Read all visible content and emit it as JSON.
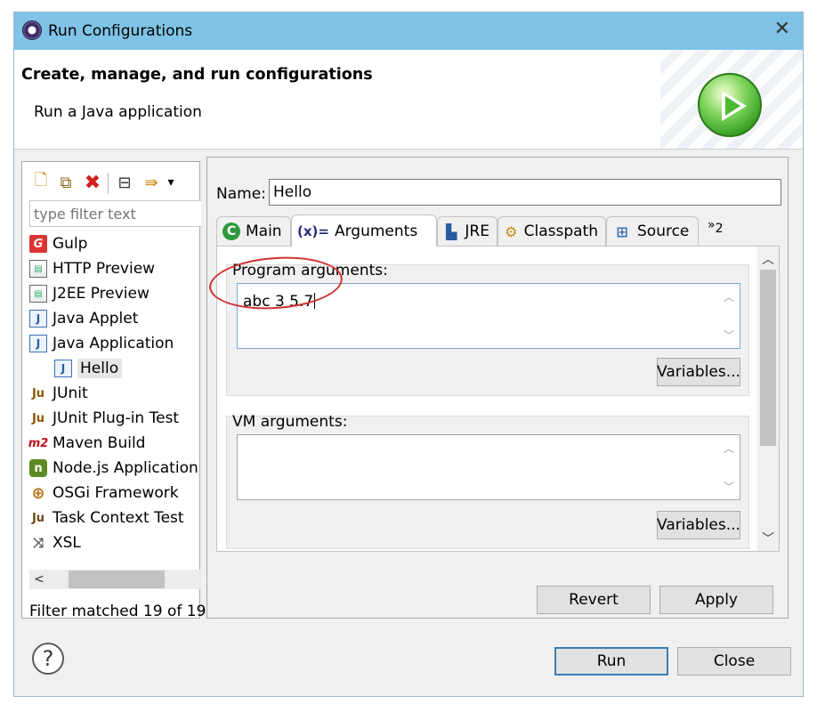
{
  "window": {
    "title": "Run Configurations",
    "close_symbol": "✕"
  },
  "header": {
    "title": "Create, manage, and run configurations",
    "subtitle": "Run a Java application"
  },
  "left_panel": {
    "filter_placeholder": "type filter text",
    "tree": [
      {
        "label": "Gulp",
        "icon": "gulp-icon",
        "glyph": "G"
      },
      {
        "label": "HTTP Preview",
        "icon": "http-preview-icon",
        "glyph": "▤"
      },
      {
        "label": "J2EE Preview",
        "icon": "j2ee-preview-icon",
        "glyph": "▤"
      },
      {
        "label": "Java Applet",
        "icon": "java-applet-icon",
        "glyph": "J"
      },
      {
        "label": "Java Application",
        "icon": "java-application-icon",
        "glyph": "J"
      },
      {
        "label": "Hello",
        "icon": "java-launch-icon",
        "glyph": "J",
        "child": true,
        "selected": true
      },
      {
        "label": "JUnit",
        "icon": "junit-icon",
        "glyph": "Ju"
      },
      {
        "label": "JUnit Plug-in Test",
        "icon": "junit-plugin-icon",
        "glyph": "Ju"
      },
      {
        "label": "Maven Build",
        "icon": "maven-icon",
        "glyph": "m2"
      },
      {
        "label": "Node.js Application",
        "icon": "nodejs-icon",
        "glyph": "n"
      },
      {
        "label": "OSGi Framework",
        "icon": "osgi-icon",
        "glyph": "⊕"
      },
      {
        "label": "Task Context Test",
        "icon": "task-context-icon",
        "glyph": "Ju"
      },
      {
        "label": "XSL",
        "icon": "xsl-icon",
        "glyph": "⤨"
      }
    ],
    "scroll_left_symbol": "<",
    "filter_status": "Filter matched 19 of 19"
  },
  "toolbar": {
    "new_icon": "🗋",
    "duplicate_icon": "⧉",
    "delete_icon": "✖",
    "collapse_icon": "⊟",
    "filter_icon": "⇛",
    "menu_icon": "▾"
  },
  "right_panel": {
    "name_label": "Name:",
    "name_value": "Hello",
    "tabs": [
      {
        "label": "Main",
        "icon": "main-tab-icon",
        "glyph": "C"
      },
      {
        "label": "Arguments",
        "icon": "arguments-tab-icon",
        "glyph": "(x)="
      },
      {
        "label": "JRE",
        "icon": "jre-tab-icon",
        "glyph": "▙"
      },
      {
        "label": "Classpath",
        "icon": "classpath-tab-icon",
        "glyph": "⚙"
      },
      {
        "label": "Source",
        "icon": "source-tab-icon",
        "glyph": "⊞"
      }
    ],
    "overflow_label": "»",
    "overflow_count": "2",
    "program_args": {
      "label": "Program arguments:",
      "value": "abc 3 5.7",
      "variables_button": "Variables..."
    },
    "vm_args": {
      "label": "VM arguments:",
      "value": "",
      "variables_button": "Variables..."
    },
    "revert_button": "Revert",
    "apply_button": "Apply"
  },
  "footer": {
    "help_symbol": "?",
    "run_button": "Run",
    "close_button": "Close"
  },
  "colors": {
    "titlebar": "#7fc3e6",
    "annotation": "#d23030",
    "run_icon": "#3aa52a"
  }
}
